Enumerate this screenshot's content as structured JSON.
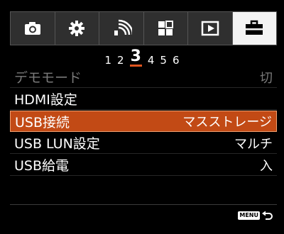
{
  "tabs": [
    {
      "icon": "camera-icon",
      "active": false
    },
    {
      "icon": "gear-icon",
      "active": false
    },
    {
      "icon": "wireless-icon",
      "active": false
    },
    {
      "icon": "apps-icon",
      "active": false
    },
    {
      "icon": "playback-icon",
      "active": false
    },
    {
      "icon": "toolbox-icon",
      "active": true
    }
  ],
  "pages": [
    "1",
    "2",
    "3",
    "4",
    "5",
    "6"
  ],
  "current_page": "3",
  "menu": {
    "items": [
      {
        "label": "デモモード",
        "value": "切",
        "state": "disabled"
      },
      {
        "label": "HDMI設定",
        "value": "",
        "state": "normal"
      },
      {
        "label": "USB接続",
        "value": "マスストレージ",
        "state": "selected"
      },
      {
        "label": "USB LUN設定",
        "value": "マルチ",
        "state": "normal"
      },
      {
        "label": "USB給電",
        "value": "入",
        "state": "normal"
      }
    ]
  },
  "footer": {
    "menu_badge": "MENU",
    "back_icon": "return-arrow-icon"
  },
  "colors": {
    "accent": "#c24a15",
    "page_underline": "#e0551f",
    "tab_active": "#f3f3f3"
  }
}
